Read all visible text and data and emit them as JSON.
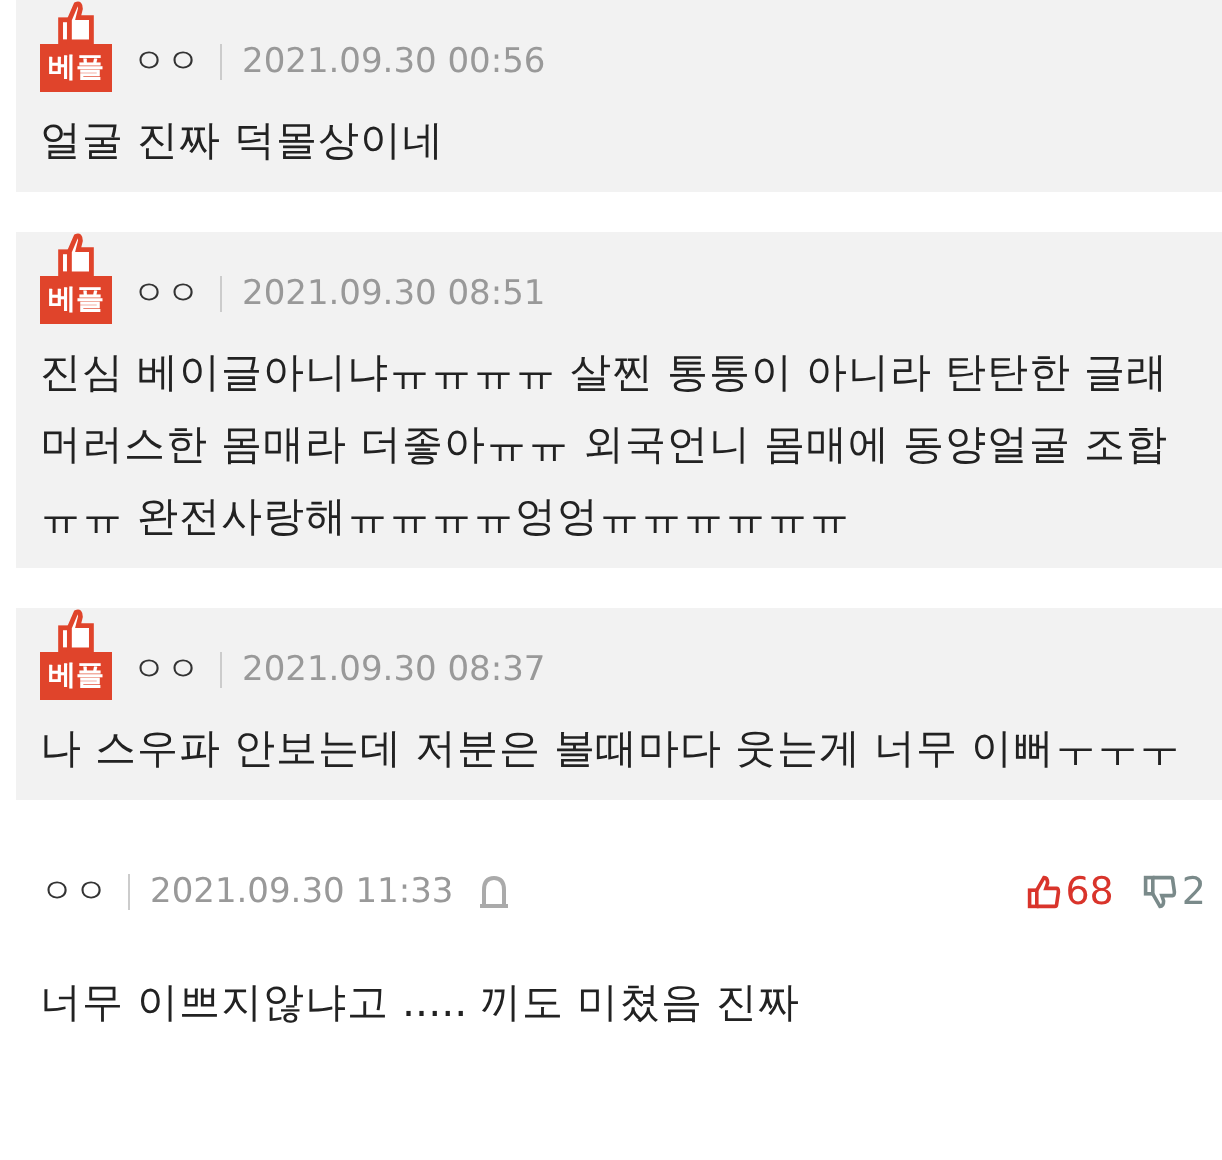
{
  "comments": [
    {
      "best": true,
      "badge": "베플",
      "author": "ㅇㅇ",
      "date": "2021.09.30 00:56",
      "text": "얼굴 진짜 덕몰상이네"
    },
    {
      "best": true,
      "badge": "베플",
      "author": "ㅇㅇ",
      "date": "2021.09.30 08:51",
      "text": "진심 베이글아니냐ㅠㅠㅠㅠ 살찐 통통이 아니라 탄탄한 글래머러스한 몸매라 더좋아ㅠㅠ 외국언니 몸매에 동양얼굴 조합ㅠㅠ 완전사랑해ㅠㅠㅠㅠ엉엉ㅠㅠㅠㅠㅠㅠ"
    },
    {
      "best": true,
      "badge": "베플",
      "author": "ㅇㅇ",
      "date": "2021.09.30 08:37",
      "text": "나 스우파 안보는데 저분은 볼때마다 웃는게 너무 이뻐ㅜㅜㅜ"
    },
    {
      "best": false,
      "author": "ㅇㅇ",
      "date": "2021.09.30 11:33",
      "likes": "68",
      "dislikes": "2",
      "text": "너무 이쁘지않냐고 ..... 끼도 미쳤음 진짜"
    }
  ]
}
